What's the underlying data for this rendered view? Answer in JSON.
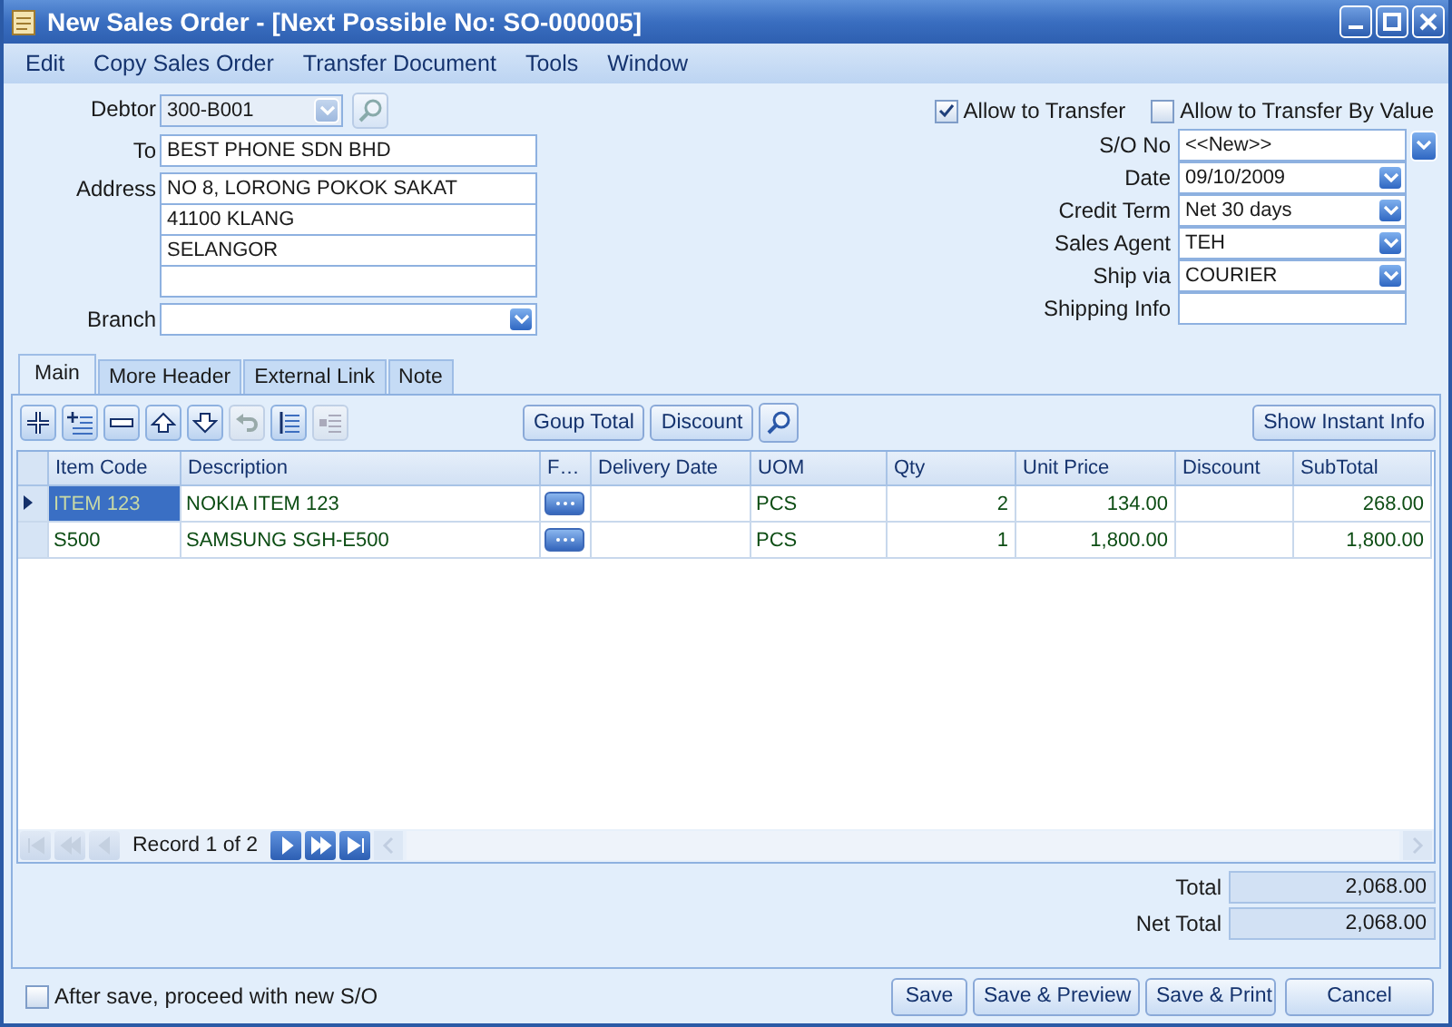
{
  "window": {
    "title": "New Sales Order - [Next Possible No: SO-000005]"
  },
  "menu": [
    "Edit",
    "Copy Sales Order",
    "Transfer Document",
    "Tools",
    "Window"
  ],
  "header_left": {
    "debtor": {
      "label": "Debtor",
      "value": "300-B001"
    },
    "to": {
      "label": "To",
      "value": "BEST PHONE SDN BHD"
    },
    "address": {
      "label": "Address",
      "lines": [
        "NO 8, LORONG POKOK SAKAT",
        "41100 KLANG",
        "SELANGOR"
      ]
    },
    "branch": {
      "label": "Branch"
    }
  },
  "options": [
    {
      "label": "Allow to Transfer",
      "checked": true
    },
    {
      "label": "Allow to Transfer By Value",
      "checked": false
    }
  ],
  "header_right": [
    {
      "label": "S/O  No",
      "value": "<<New>>",
      "kind": "outside-dropdown"
    },
    {
      "label": "Date",
      "value": "09/10/2009",
      "kind": "dropdown"
    },
    {
      "label": "Credit Term",
      "value": "Net 30 days",
      "kind": "dropdown"
    },
    {
      "label": "Sales Agent",
      "value": "TEH",
      "kind": "dropdown"
    },
    {
      "label": "Ship via",
      "value": "COURIER",
      "kind": "dropdown"
    },
    {
      "label": "Shipping Info",
      "kind": "text"
    }
  ],
  "tabs": [
    {
      "label": "Main",
      "selected": true
    },
    {
      "label": "More Header",
      "selected": false
    },
    {
      "label": "External Link",
      "selected": false
    },
    {
      "label": "Note",
      "selected": false
    }
  ],
  "tool_buttons": [
    {
      "kind": "add",
      "disabled": false
    },
    {
      "kind": "insert",
      "disabled": false
    },
    {
      "kind": "remove",
      "disabled": false
    },
    {
      "kind": "up",
      "disabled": false
    },
    {
      "kind": "down",
      "disabled": false
    },
    {
      "kind": "undo",
      "disabled": true
    },
    {
      "kind": "list",
      "disabled": false
    },
    {
      "kind": "outdent",
      "disabled": true
    }
  ],
  "actions": [
    "Goup Total",
    "Discount"
  ],
  "instant_info": "Show Instant Info",
  "table": {
    "columns": [
      "Item Code",
      "Description",
      "F…",
      "Delivery Date",
      "UOM",
      "Qty",
      "Unit Price",
      "Discount",
      "SubTotal"
    ],
    "rows": [
      {
        "selected": true,
        "item_code": "ITEM 123",
        "description": "NOKIA ITEM 123",
        "uom": "PCS",
        "qty": "2",
        "unit_price": "134.00",
        "subtotal": "268.00"
      },
      {
        "selected": false,
        "item_code": "S500",
        "description": "SAMSUNG SGH-E500",
        "uom": "PCS",
        "qty": "1",
        "unit_price": "1,800.00",
        "subtotal": "1,800.00"
      }
    ]
  },
  "navigator": {
    "record": "Record 1 of 2",
    "buttons": [
      {
        "kind": "first",
        "disabled": true
      },
      {
        "kind": "prev-page",
        "disabled": true
      },
      {
        "kind": "prev",
        "disabled": true
      },
      {
        "kind": "next",
        "disabled": false
      },
      {
        "kind": "next-page",
        "disabled": false
      },
      {
        "kind": "last",
        "disabled": false
      }
    ]
  },
  "totals": [
    {
      "label": "Total",
      "value": "2,068.00"
    },
    {
      "label": "Net Total",
      "value": "2,068.00"
    }
  ],
  "footer": {
    "option": {
      "label": "After save, proceed with new S/O",
      "checked": false
    },
    "buttons": [
      "Save",
      "Save & Preview",
      "Save & Print",
      "Cancel"
    ]
  }
}
